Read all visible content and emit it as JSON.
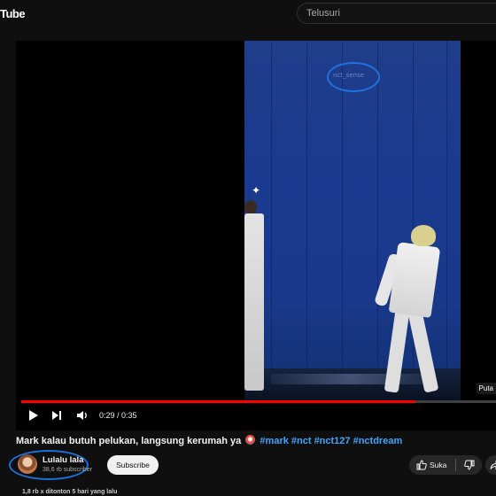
{
  "header": {
    "logo_text": "Tube",
    "search_placeholder": "Telusuri"
  },
  "player": {
    "watermark": "nct_sense",
    "hint": "Puta",
    "time": "0:29 / 0:35",
    "progress_fraction": 0.83,
    "progress_color": "#ff0000"
  },
  "video": {
    "title": "Mark kalau butuh pelukan, langsung kerumah ya",
    "hashtags": "#mark #nct #nct127 #nctdream",
    "channel_name": "Lulalu lala",
    "subscribers": "38,6 rb subscriber",
    "subscribe_label": "Subscribe",
    "like_label": "Suka",
    "views_line": "1,8 rb x ditonton  5 hari yang lalu"
  },
  "colors": {
    "background": "#0f0f0f",
    "hashtag": "#3ea6ff",
    "annotation_circle": "#1c6fd9"
  }
}
